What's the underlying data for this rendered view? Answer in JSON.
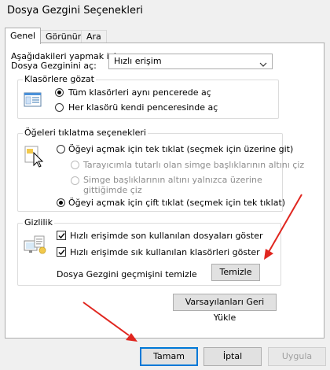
{
  "window": {
    "title": "Dosya Gezgini Seçenekleri"
  },
  "tabs": [
    {
      "label": "Genel",
      "active": true
    },
    {
      "label": "Görünüm",
      "active": false
    },
    {
      "label": "Ara",
      "active": false
    }
  ],
  "open_with": {
    "label_line1": "Aşağıdakileri yapmak için",
    "label_line2": "Dosya Gezginini aç:",
    "selected": "Hızlı erişim"
  },
  "browse_folders": {
    "title": "Klasörlere gözat",
    "option_same": "Tüm klasörleri aynı pencerede aç",
    "option_new": "Her klasörü kendi penceresinde aç",
    "selected": "same"
  },
  "click_items": {
    "title": "Öğeleri tıklatma seçenekleri",
    "option_single": "Öğeyi açmak için tek tıklat (seçmek için üzerine git)",
    "sub_browser": "Tarayıcımla tutarlı olan simge başlıklarının altını çiz",
    "sub_hover_line1": "Simge başlıklarının altını yalnızca üzerine",
    "sub_hover_line2": "gittiğimde çiz",
    "option_double": "Öğeyi açmak için çift tıklat (seçmek için tek tıklat)",
    "selected": "double"
  },
  "privacy": {
    "title": "Gizlilik",
    "recent_files": "Hızlı erişimde son kullanılan dosyaları göster",
    "frequent_folders": "Hızlı erişimde sık kullanılan klasörleri göster",
    "recent_files_checked": true,
    "frequent_folders_checked": true,
    "clear_label": "Dosya Gezgini geçmişini temizle",
    "clear_button": "Temizle"
  },
  "restore_button": "Varsayılanları Geri Yükle",
  "footer": {
    "ok": "Tamam",
    "cancel": "İptal",
    "apply": "Uygula"
  },
  "colors": {
    "accent": "#0078d7",
    "annotation_arrow": "#e0261f"
  },
  "icons": [
    "chevron-down-icon",
    "folder-window-icon",
    "cursor-click-icon",
    "privacy-icon",
    "checkmark-icon",
    "red-arrow-annotation"
  ]
}
